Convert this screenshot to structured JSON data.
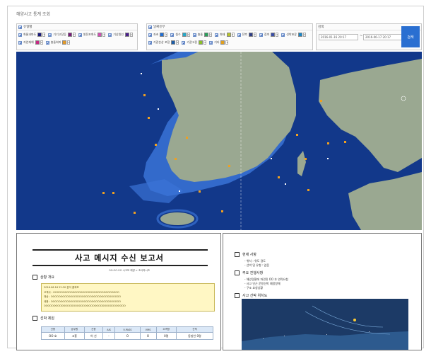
{
  "app": {
    "title": "해양사고 통계 조회"
  },
  "filters": {
    "group1": {
      "header": "유형별",
      "items": [
        {
          "label": "화물과파도",
          "color": "#1a1a7a"
        },
        {
          "label": "기기고장등",
          "color": "#7a1a7a"
        },
        {
          "label": "발전포화도",
          "color": "#d24fb3"
        },
        {
          "label": "기상원인",
          "color": "#4a1e8c"
        },
        {
          "label": "자연재해",
          "color": "#c62a84"
        },
        {
          "label": "충돌회피",
          "color": "#e29a2a"
        }
      ]
    },
    "group2": {
      "header": "날짜유무",
      "items": [
        {
          "label": "좌초",
          "color": "#1f6fd8"
        },
        {
          "label": "침수",
          "color": "#25a8c9"
        },
        {
          "label": "충돌",
          "color": "#2a9f5a"
        },
        {
          "label": "화재",
          "color": "#b8c42a"
        },
        {
          "label": "전복",
          "color": "#2d3d86"
        },
        {
          "label": "접촉",
          "color": "#3a4ea8"
        },
        {
          "label": "선박표류",
          "color": "#1a87c8"
        },
        {
          "label": "기관손상 포함",
          "color": "#1e5ea8"
        },
        {
          "label": "기관고장",
          "color": "#8bc02a"
        },
        {
          "label": "기타",
          "color": "#e0a020"
        }
      ]
    },
    "period": {
      "header": "검색",
      "start": "2016-01-16 20:17",
      "end": "2016-06-17 20:17",
      "separator": "~"
    },
    "search_label": "검색"
  },
  "report": {
    "title": "사고 메시지 수신 보고서",
    "subtitle": "OO.OO.OO 시고보 해양 > 조사하시즈",
    "section1": "상황 개요",
    "notes": [
      "2016.06.16 22:30 분석 결과보",
      "고객사 : OOOOOOOOOOOOOOOOOOOOOOOOOOOOOOOOOO",
      "대상 : OOOOOOOOOOOOOOOOOOOOOOOOOOOOOOOOOOOO",
      "내용 : OOOOOOOOOOOOOOOOOOOOOOOOOOOOOOOOOOOO",
      "OOOOOOOOOOOOOOOOOOOOOOOOOOOOOOOOOOOOOOOOOO"
    ],
    "section2": "선박 제원",
    "table": {
      "headers": [
        "선명",
        "승무원",
        "선종",
        "AIS",
        "V-PASS",
        "VMS",
        "소속항",
        "선적"
      ],
      "row": [
        "OO 호",
        "고흥",
        "어 선",
        "-",
        "O",
        "O",
        "0명",
        "동방인 0명"
      ]
    }
  },
  "report2": {
    "section1": "현재 사항",
    "list1": [
      "- 위치 : 위도 경도",
      "- 선박 및 유형 : 없음"
    ],
    "section2": "주요 진행사항",
    "list2": [
      "- 해양경찰에 파견된 OO 호 연락요청",
      "- 사고 인근 운항선박 예정항해",
      "- 구조 요청상황"
    ],
    "section3": "사고 선박 위치도"
  }
}
